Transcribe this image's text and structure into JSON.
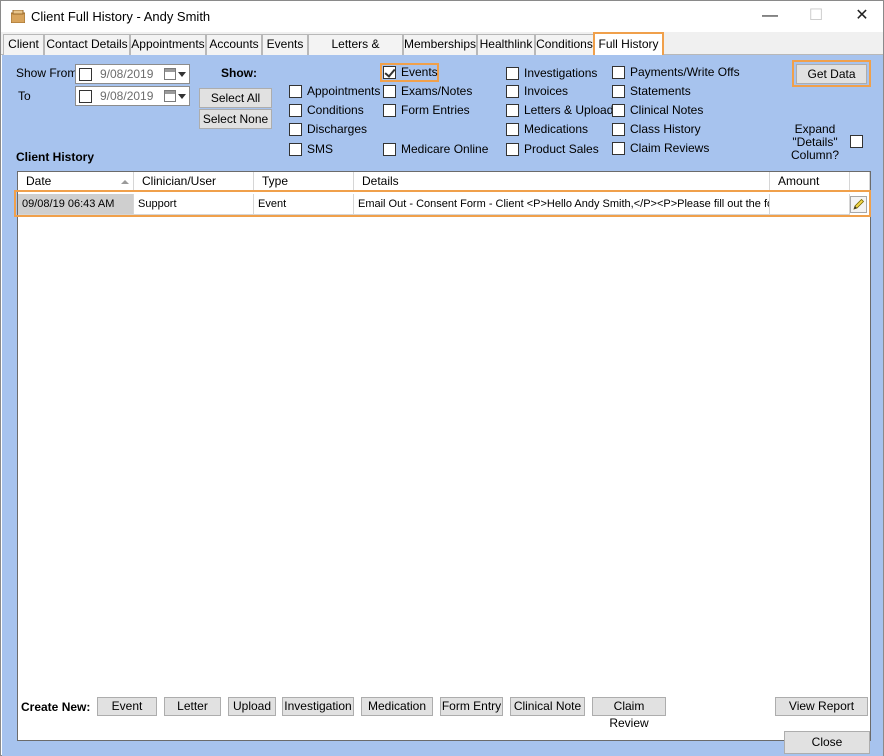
{
  "window": {
    "title": "Client Full History - Andy Smith",
    "min": "—",
    "max": "☐",
    "close": "✕"
  },
  "tabs": [
    "Client",
    "Contact Details",
    "Appointments",
    "Accounts",
    "Events",
    "Letters & Uploads",
    "Memberships",
    "Healthlink",
    "Conditions",
    "Full History"
  ],
  "filters": {
    "show_from_label": "Show From",
    "to_label": "To",
    "from_date": "9/08/2019",
    "to_date": "9/08/2019",
    "show_label": "Show:",
    "select_all": "Select All",
    "select_none": "Select None",
    "get_data": "Get Data",
    "expand_details": "Expand \"Details\" Column?"
  },
  "checkboxes": {
    "appointments": {
      "label": "Appointments",
      "checked": false
    },
    "conditions": {
      "label": "Conditions",
      "checked": false
    },
    "discharges": {
      "label": "Discharges",
      "checked": false
    },
    "sms": {
      "label": "SMS",
      "checked": false
    },
    "events": {
      "label": "Events",
      "checked": true
    },
    "exams_notes": {
      "label": "Exams/Notes",
      "checked": false
    },
    "form_entries": {
      "label": "Form Entries",
      "checked": false
    },
    "medicare_online": {
      "label": "Medicare Online",
      "checked": false
    },
    "investigations": {
      "label": "Investigations",
      "checked": false
    },
    "invoices": {
      "label": "Invoices",
      "checked": false
    },
    "letters_uploads": {
      "label": "Letters & Uploads",
      "checked": false
    },
    "medications": {
      "label": "Medications",
      "checked": false
    },
    "product_sales": {
      "label": "Product Sales",
      "checked": false
    },
    "payments_write_offs": {
      "label": "Payments/Write Offs",
      "checked": false
    },
    "statements": {
      "label": "Statements",
      "checked": false
    },
    "clinical_notes": {
      "label": "Clinical Notes",
      "checked": false
    },
    "class_history": {
      "label": "Class History",
      "checked": false
    },
    "claim_reviews": {
      "label": "Claim Reviews",
      "checked": false
    }
  },
  "history": {
    "title": "Client History",
    "columns": [
      "Date",
      "Clinician/User",
      "Type",
      "Details",
      "Amount"
    ],
    "rows": [
      {
        "date": "09/08/19 06:43 AM",
        "clinician": "Support",
        "type": "Event",
        "details": "Email Out - Consent Form - Client <P>Hello Andy Smith,</P><P>Please fill out the foll...",
        "amount": ""
      }
    ]
  },
  "create_new": {
    "label": "Create New:",
    "buttons": [
      "Event",
      "Letter",
      "Upload",
      "Investigation",
      "Medication",
      "Form Entry",
      "Clinical Note",
      "Claim Review"
    ]
  },
  "view_report": "View Report",
  "close_button": "Close",
  "colors": {
    "panel": "#a7c3ee",
    "highlight": "#f0a04b"
  }
}
